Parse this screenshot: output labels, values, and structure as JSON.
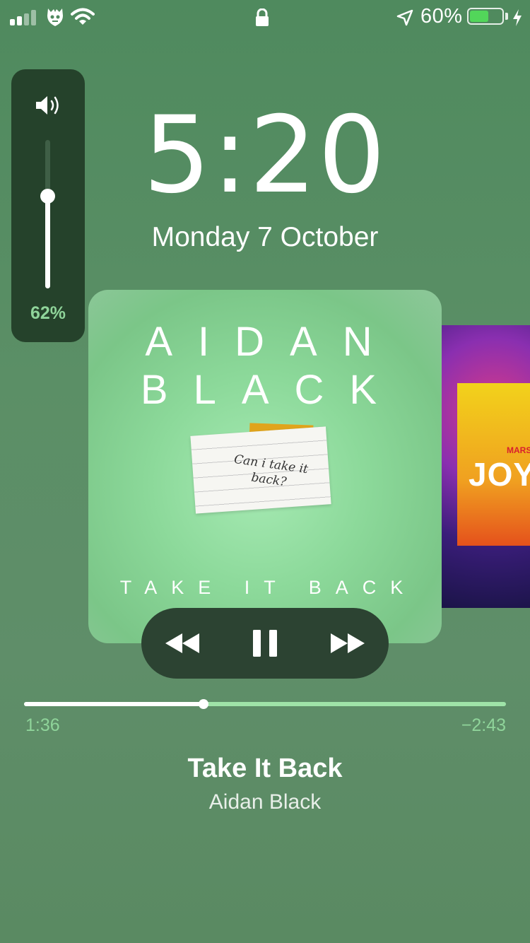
{
  "status_bar": {
    "signal_bars": 4,
    "signal_active": 2,
    "carrier_icon": "carrier-logo-icon",
    "wifi_icon": "wifi-icon",
    "lock_icon": "lock-icon",
    "location_icon": "location-arrow-icon",
    "battery_percent_text": "60%",
    "battery_level": 0.6,
    "charging_icon": "bolt-icon"
  },
  "volume_hud": {
    "icon": "speaker-icon",
    "level": 0.62,
    "percent_text": "62%"
  },
  "lock_screen": {
    "time": "5:20",
    "date": "Monday 7 October"
  },
  "now_playing": {
    "artwork": {
      "line1": "AIDAN",
      "line2": "BLACK",
      "line3": "TAKE IT BACK",
      "note_text": "Can i take it back?"
    },
    "next_artwork": {
      "text": "JOY",
      "small_text": "MARSH"
    },
    "controls": {
      "rewind": "rewind-icon",
      "pause": "pause-icon",
      "fast_forward": "fast-forward-icon"
    },
    "progress": {
      "elapsed": "1:36",
      "remaining": "−2:43",
      "fraction": 0.372
    },
    "song_title": "Take It Back",
    "artist": "Aidan Black"
  },
  "colors": {
    "background": "#5b8f66",
    "accent_green": "#8fd49a",
    "hud": "#25422b",
    "battery_fill": "#52d65a"
  }
}
